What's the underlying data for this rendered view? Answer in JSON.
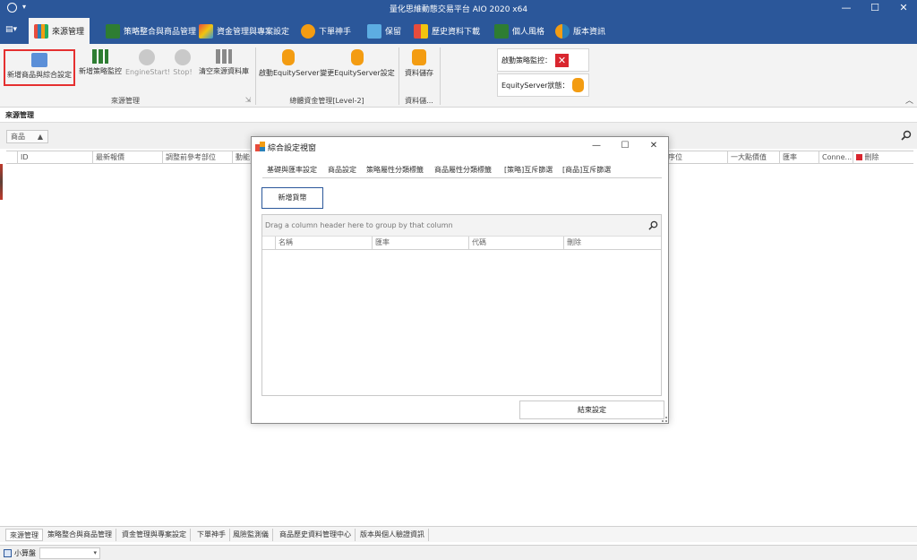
{
  "window": {
    "title": "量化思維動態交易平台 AIO 2020 x64",
    "controls": {
      "minimize": "—",
      "maximize": "☐",
      "close": "✕"
    }
  },
  "ribbon_tabs": [
    {
      "label": "來源管理",
      "active": true
    },
    {
      "label": "策略整合與商品管理"
    },
    {
      "label": "資金管理與專案設定"
    },
    {
      "label": "下單神手"
    },
    {
      "label": "保留"
    },
    {
      "label": "歷史資料下載"
    },
    {
      "label": "個人風格"
    },
    {
      "label": "版本資訊"
    }
  ],
  "ribbon": {
    "buttons": [
      {
        "label": "新增商品與綜合設定",
        "selected": true
      },
      {
        "label": "新增策略監控"
      },
      {
        "label": "EngineStart!",
        "disabled": true
      },
      {
        "label": "Stop!",
        "disabled": true
      },
      {
        "label": "清空來源資料庫"
      },
      {
        "label": "啟動EquityServer"
      },
      {
        "label": "變更EquityServer設定"
      },
      {
        "label": "資料儲存"
      }
    ],
    "groups": [
      "來源管理",
      "總體資金管理[Level-2]",
      "資料儲..."
    ],
    "strategy_monitor_label": "啟動策略監控：",
    "equity_server_label": "EquityServer狀態："
  },
  "main": {
    "page_title": "來源管理",
    "filter_tag": "商品",
    "grid_columns": [
      "ID",
      "最新報價",
      "調整前參考部位",
      "動能",
      "序位",
      "一大點價值",
      "匯率",
      "Conne...",
      "刪除"
    ]
  },
  "dialog": {
    "title": "綜合設定視窗",
    "tabs": [
      "基礎與匯率設定",
      "商品設定",
      "策略屬性分類標籤",
      "商品屬性分類標籤",
      "[策略]互斥篩選",
      "[商品]互斥篩選"
    ],
    "new_button": "新增貨幣",
    "group_hint": "Drag a column header here to group by that column",
    "columns": [
      "名稱",
      "匯率",
      "代碼",
      "刪除"
    ],
    "end_button": "結束設定"
  },
  "bottom_tabs": [
    "來源管理",
    "策略整合與商品管理",
    "資金管理與專案設定",
    "下單神手",
    "風險監測儀",
    "商品歷史資料管理中心",
    "版本與個人驗證資訊"
  ],
  "status": {
    "calc_label": "小算盤"
  }
}
